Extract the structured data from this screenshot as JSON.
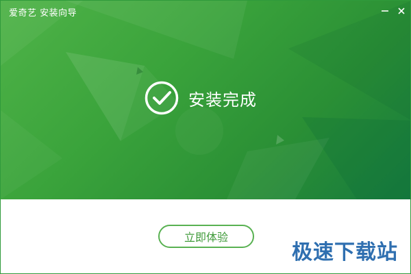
{
  "window": {
    "title": "爱奇艺 安装向导",
    "minimize_icon": "minimize-icon",
    "close_icon": "close-icon"
  },
  "hero": {
    "status_text": "安装完成",
    "status_icon": "check-circle-icon"
  },
  "footer": {
    "action_label": "立即体验"
  },
  "watermark": {
    "text": "极速下载站"
  },
  "colors": {
    "accent_green": "#3aa33b",
    "button_border": "#58b151",
    "button_text": "#3f9a39",
    "watermark": "#2f6fb0"
  }
}
